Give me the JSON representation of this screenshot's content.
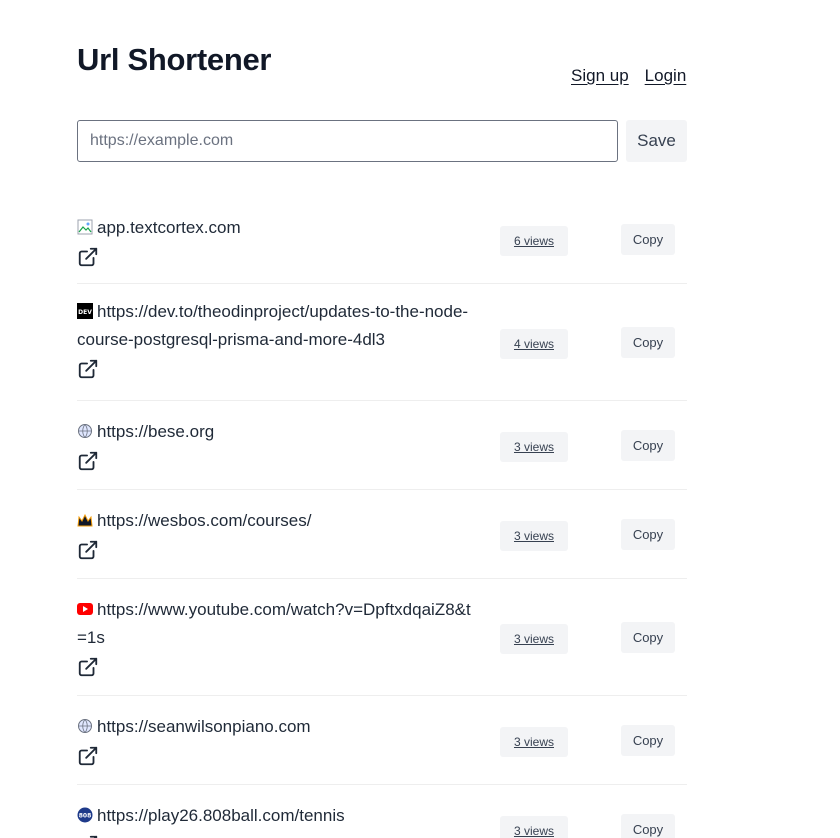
{
  "app": {
    "title": "Url Shortener"
  },
  "nav": {
    "signup": "Sign up",
    "login": "Login"
  },
  "form": {
    "placeholder": "https://example.com",
    "value": "",
    "save_label": "Save"
  },
  "links": [
    {
      "url": "app.textcortex.com",
      "views": "6 views",
      "copy": "Copy",
      "favicon": "broken-image-icon"
    },
    {
      "url": "https://dev.to/theodinproject/updates-to-the-node-course-postgresql-prisma-and-more-4dl3",
      "views": "4 views",
      "copy": "Copy",
      "favicon": "dev-icon"
    },
    {
      "url": "https://bese.org",
      "views": "3 views",
      "copy": "Copy",
      "favicon": "globe-icon"
    },
    {
      "url": "https://wesbos.com/courses/",
      "views": "3 views",
      "copy": "Copy",
      "favicon": "crown-icon"
    },
    {
      "url": "https://www.youtube.com/watch?v=DpftxdqaiZ8&t=1s",
      "views": "3 views",
      "copy": "Copy",
      "favicon": "youtube-icon"
    },
    {
      "url": "https://seanwilsonpiano.com",
      "views": "3 views",
      "copy": "Copy",
      "favicon": "globe-icon"
    },
    {
      "url": "https://play26.808ball.com/tennis",
      "views": "3 views",
      "copy": "Copy",
      "favicon": "808ball-icon"
    }
  ],
  "colors": {
    "button_bg": "#f3f4f6",
    "text": "#1f2937",
    "divider": "#eeeeee"
  }
}
